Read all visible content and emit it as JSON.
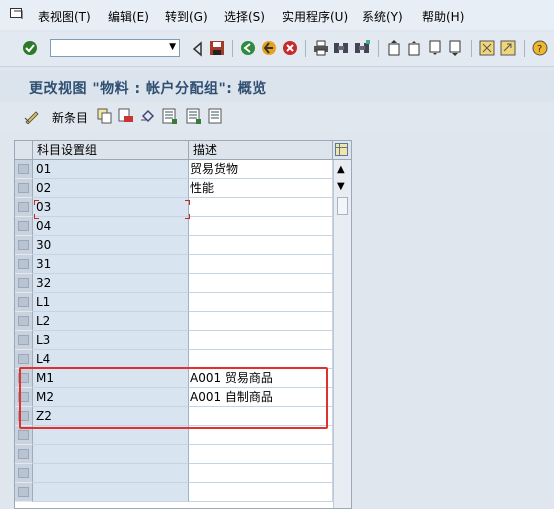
{
  "menu": {
    "items": [
      {
        "label": "表视图(T)"
      },
      {
        "label": "编辑(E)"
      },
      {
        "label": "转到(G)"
      },
      {
        "label": "选择(S)"
      },
      {
        "label": "实用程序(U)"
      },
      {
        "label": "系统(Y)"
      },
      {
        "label": "帮助(H)"
      }
    ]
  },
  "command_field": {
    "value": ""
  },
  "title": "更改视图 \"物料 :  帐户分配组\": 概览",
  "app_toolbar": {
    "new_entries_label": "新条目"
  },
  "table": {
    "headers": [
      "科目设置组",
      "描述"
    ],
    "rows": [
      {
        "key": "01",
        "desc": "贸易货物"
      },
      {
        "key": "02",
        "desc": "性能"
      },
      {
        "key": "03",
        "desc": ""
      },
      {
        "key": "04",
        "desc": ""
      },
      {
        "key": "30",
        "desc": ""
      },
      {
        "key": "31",
        "desc": ""
      },
      {
        "key": "32",
        "desc": ""
      },
      {
        "key": "L1",
        "desc": ""
      },
      {
        "key": "L2",
        "desc": ""
      },
      {
        "key": "L3",
        "desc": ""
      },
      {
        "key": "L4",
        "desc": ""
      },
      {
        "key": "M1",
        "desc": "A001 贸易商品"
      },
      {
        "key": "M2",
        "desc": "A001 自制商品"
      },
      {
        "key": "Z2",
        "desc": ""
      }
    ]
  },
  "colors": {
    "highlight": "#e03030",
    "title": "#2f4f72",
    "key_column": "#d8e4f0"
  }
}
